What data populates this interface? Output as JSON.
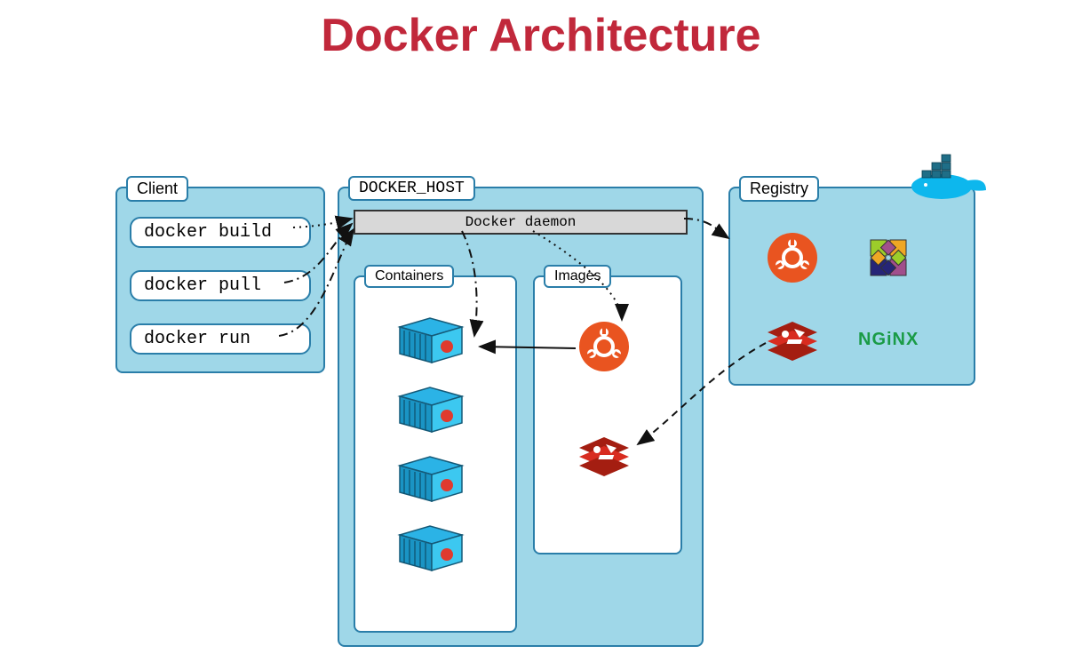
{
  "title": "Docker Architecture",
  "client": {
    "label": "Client",
    "commands": [
      "docker build",
      "docker pull",
      "docker run"
    ]
  },
  "host": {
    "label": "DOCKER_HOST",
    "daemon": "Docker daemon",
    "containers_label": "Containers",
    "images_label": "Images"
  },
  "registry": {
    "label": "Registry",
    "logos": [
      "ubuntu",
      "centos",
      "redis",
      "nginx"
    ]
  },
  "images_in_host": [
    "ubuntu",
    "redis"
  ],
  "arrows": [
    {
      "from": "docker build",
      "to": "Docker daemon",
      "style": "dotted"
    },
    {
      "from": "docker pull",
      "to": "Docker daemon",
      "style": "dashdot"
    },
    {
      "from": "docker run",
      "to": "Docker daemon",
      "style": "dashdot"
    },
    {
      "from": "Docker daemon",
      "to": "Registry",
      "style": "dashdot"
    },
    {
      "from": "Docker daemon",
      "to": "Images.ubuntu",
      "style": "dotted"
    },
    {
      "from": "Docker daemon",
      "to": "Containers",
      "style": "dashdot"
    },
    {
      "from": "Images.ubuntu",
      "to": "Containers",
      "style": "solid"
    },
    {
      "from": "Registry.redis",
      "to": "Images.redis",
      "style": "dashed"
    }
  ]
}
